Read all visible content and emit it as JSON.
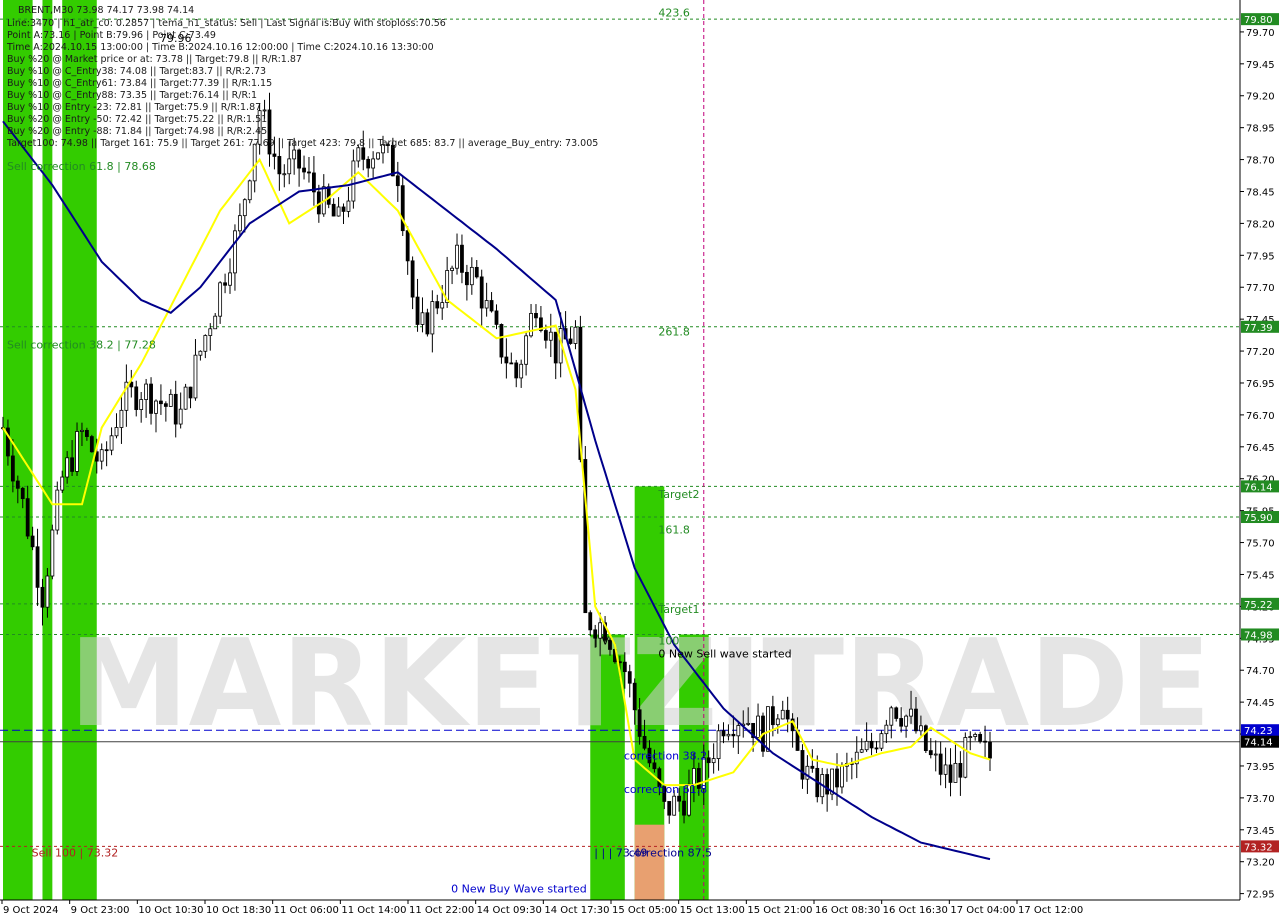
{
  "header": {
    "symbol_line": "BRENT,M30  73.98 74.17 73.98 74.14",
    "info_lines": [
      "Line:3470  | h1_atr_c0: 0.2857  | tema_h1_status:  Sell  | Last Signal is:Buy with stoploss:70.56",
      "Point A:73.16  | Point B:79.96  | Point C:73.49",
      "Time A:2024.10.15 13:00:00  | Time B:2024.10.16 12:00:00  | Time C:2024.10.16 13:30:00",
      "Buy %20 @ Market price or at: 73.78  || Target:79.8  || R/R:1.87",
      "Buy %10 @ C_Entry38: 74.08  || Target:83.7  || R/R:2.73",
      "Buy %10 @ C_Entry61: 73.84  || Target:77.39  || R/R:1.15",
      "Buy %10 @ C_Entry88: 73.35  || Target:76.14  || R/R:1",
      "Buy %10 @ Entry -23: 72.81  || Target:75.9  || R/R:1.87",
      "Buy %20 @ Entry -50: 72.42  || Target:75.22  || R/R:1.51",
      "Buy %20 @ Entry -88: 71.84  || Target:74.98  || R/R:2.45",
      "Target100: 74.98  || Target 161: 75.9  || Target 261: 77.69  || Target 423: 79.8  || Target 685: 83.7  || average_Buy_entry: 73.005"
    ]
  },
  "watermark": "MARKETZITRADE",
  "chart_data": {
    "type": "candlestick",
    "symbol": "BRENT",
    "timeframe": "M30",
    "ylim": [
      72.9,
      79.95
    ],
    "y_ticks": [
      "79.70",
      "79.45",
      "79.20",
      "78.95",
      "78.70",
      "78.45",
      "78.20",
      "77.95",
      "77.70",
      "77.45",
      "77.20",
      "76.95",
      "76.70",
      "76.45",
      "76.20",
      "75.95",
      "75.70",
      "75.45",
      "75.20",
      "74.95",
      "74.70",
      "74.45",
      "74.20",
      "73.95",
      "73.70",
      "73.45",
      "73.20",
      "72.95"
    ],
    "x_ticks": [
      "9 Oct 2024",
      "9 Oct 23:00",
      "10 Oct 10:30",
      "10 Oct 18:30",
      "11 Oct 06:00",
      "11 Oct 14:00",
      "11 Oct 22:00",
      "14 Oct 09:30",
      "14 Oct 17:30",
      "15 Oct 05:00",
      "15 Oct 13:00",
      "15 Oct 21:00",
      "16 Oct 08:30",
      "16 Oct 16:30",
      "17 Oct 04:00",
      "17 Oct 12:00"
    ],
    "series_close_keypoints": [
      [
        0,
        76.6
      ],
      [
        4,
        76.0
      ],
      [
        8,
        75.3
      ],
      [
        12,
        76.2
      ],
      [
        16,
        76.55
      ],
      [
        20,
        76.3
      ],
      [
        24,
        76.8
      ],
      [
        28,
        76.9
      ],
      [
        32,
        76.8
      ],
      [
        36,
        76.7
      ],
      [
        40,
        77.2
      ],
      [
        44,
        77.7
      ],
      [
        48,
        78.2
      ],
      [
        52,
        79.1
      ],
      [
        56,
        78.6
      ],
      [
        60,
        78.65
      ],
      [
        64,
        78.4
      ],
      [
        68,
        78.2
      ],
      [
        72,
        78.7
      ],
      [
        76,
        78.8
      ],
      [
        80,
        78.6
      ],
      [
        84,
        77.3
      ],
      [
        88,
        77.6
      ],
      [
        92,
        77.9
      ],
      [
        96,
        77.75
      ],
      [
        100,
        77.3
      ],
      [
        104,
        77.0
      ],
      [
        108,
        77.6
      ],
      [
        112,
        77.2
      ],
      [
        116,
        77.35
      ],
      [
        118,
        75.1
      ],
      [
        122,
        75.05
      ],
      [
        126,
        74.7
      ],
      [
        130,
        74.1
      ],
      [
        134,
        73.6
      ],
      [
        138,
        73.7
      ],
      [
        142,
        73.9
      ],
      [
        146,
        74.3
      ],
      [
        150,
        74.35
      ],
      [
        154,
        74.2
      ],
      [
        158,
        74.5
      ],
      [
        160,
        74.1
      ],
      [
        164,
        73.8
      ],
      [
        168,
        73.8
      ],
      [
        172,
        73.95
      ],
      [
        176,
        74.1
      ],
      [
        180,
        74.45
      ],
      [
        184,
        74.3
      ],
      [
        188,
        74.0
      ],
      [
        192,
        73.85
      ],
      [
        196,
        74.1
      ],
      [
        200,
        74.02
      ]
    ],
    "n_bars": 201,
    "series": [
      {
        "name": "",
        "color": "#ffff00"
      },
      {
        "name": "",
        "color": "#00008b"
      }
    ],
    "yellow_line_keypoints": [
      [
        0,
        76.6
      ],
      [
        10,
        76.0
      ],
      [
        16,
        76.0
      ],
      [
        20,
        76.6
      ],
      [
        28,
        77.1
      ],
      [
        36,
        77.7
      ],
      [
        44,
        78.3
      ],
      [
        52,
        78.7
      ],
      [
        58,
        78.2
      ],
      [
        66,
        78.4
      ],
      [
        72,
        78.6
      ],
      [
        80,
        78.3
      ],
      [
        90,
        77.6
      ],
      [
        100,
        77.3
      ],
      [
        112,
        77.4
      ],
      [
        116,
        76.9
      ],
      [
        120,
        75.2
      ],
      [
        124,
        74.9
      ],
      [
        128,
        74.0
      ],
      [
        134,
        73.8
      ],
      [
        140,
        73.8
      ],
      [
        148,
        73.9
      ],
      [
        154,
        74.2
      ],
      [
        160,
        74.3
      ],
      [
        164,
        74.0
      ],
      [
        170,
        73.95
      ],
      [
        178,
        74.05
      ],
      [
        184,
        74.1
      ],
      [
        188,
        74.25
      ],
      [
        196,
        74.05
      ],
      [
        200,
        74.0
      ]
    ],
    "blue_line_keypoints": [
      [
        0,
        79.0
      ],
      [
        10,
        78.5
      ],
      [
        20,
        77.9
      ],
      [
        28,
        77.6
      ],
      [
        34,
        77.5
      ],
      [
        40,
        77.7
      ],
      [
        50,
        78.2
      ],
      [
        60,
        78.45
      ],
      [
        70,
        78.5
      ],
      [
        80,
        78.6
      ],
      [
        90,
        78.3
      ],
      [
        100,
        78.0
      ],
      [
        112,
        77.6
      ],
      [
        120,
        76.5
      ],
      [
        128,
        75.5
      ],
      [
        136,
        74.9
      ],
      [
        146,
        74.4
      ],
      [
        156,
        74.05
      ],
      [
        166,
        73.8
      ],
      [
        176,
        73.55
      ],
      [
        186,
        73.35
      ],
      [
        200,
        73.22
      ]
    ],
    "horizontal_levels": [
      {
        "label": "77.39",
        "price": 77.39,
        "color": "#228b22",
        "style": "dotted"
      },
      {
        "label": "76.14",
        "price": 76.14,
        "color": "#228b22",
        "style": "dotted"
      },
      {
        "label": "75.90",
        "price": 75.9,
        "color": "#228b22",
        "style": "dotted"
      },
      {
        "label": "75.22",
        "price": 75.22,
        "color": "#228b22",
        "style": "dotted"
      },
      {
        "label": "74.98",
        "price": 74.98,
        "color": "#228b22",
        "style": "dotted"
      },
      {
        "label": "74.23",
        "price": 74.23,
        "color": "#0000cd",
        "style": "dashed"
      },
      {
        "label": "74.14",
        "price": 74.14,
        "color": "#404040",
        "style": "solid"
      },
      {
        "label": "73.32",
        "price": 73.32,
        "color": "#b22222",
        "style": "dotted"
      },
      {
        "label": "79.80",
        "price": 79.8,
        "color": "#228b22",
        "style": "dotted"
      }
    ],
    "annotations": [
      {
        "text": "423.6",
        "price": 79.82,
        "bar": 132,
        "color": "#228b22"
      },
      {
        "text": "261.8",
        "price": 77.32,
        "bar": 132,
        "color": "#228b22"
      },
      {
        "text": "Target2",
        "price": 76.05,
        "bar": 132,
        "color": "#228b22"
      },
      {
        "text": "161.8",
        "price": 75.77,
        "bar": 132,
        "color": "#228b22"
      },
      {
        "text": "Target1",
        "price": 75.15,
        "bar": 132,
        "color": "#228b22"
      },
      {
        "text": "100",
        "price": 74.9,
        "bar": 132,
        "color": "#228b22"
      },
      {
        "text": "0 New Sell wave started",
        "price": 74.8,
        "bar": 132,
        "color": "#000000"
      },
      {
        "text": "Sell correction 61.8 | 78.68",
        "price": 78.62,
        "bar": 0,
        "color": "#228b22"
      },
      {
        "text": "Sell correction 38.2 | 77.28",
        "price": 77.22,
        "bar": 0,
        "color": "#228b22"
      },
      {
        "text": "Sell 100 | 73.32",
        "price": 73.24,
        "bar": 5,
        "color": "#b22222"
      },
      {
        "text": "| V",
        "price": 74.9,
        "bar": 119,
        "color": "#000000"
      },
      {
        "text": "correction 38.2",
        "price": 74.0,
        "bar": 125,
        "color": "#0000cd"
      },
      {
        "text": "correction 61.8",
        "price": 73.74,
        "bar": 125,
        "color": "#0000cd"
      },
      {
        "text": "| | | 73.49",
        "price": 73.24,
        "bar": 119,
        "color": "#00008b"
      },
      {
        "text": "correction 87.5",
        "price": 73.24,
        "bar": 126,
        "color": "#00008b"
      },
      {
        "text": "79.96",
        "price": 79.62,
        "bar": 31,
        "color": "#000000"
      },
      {
        "text": "0 New Buy Wave started",
        "price": 72.96,
        "bar": 90,
        "color": "#0000cd"
      }
    ],
    "zones": [
      {
        "from_bar": 0,
        "to_bar": 6,
        "color": "#33cc00",
        "from_price": 72.9,
        "to_price": 79.95
      },
      {
        "from_bar": 8,
        "to_bar": 10,
        "color": "#33cc00",
        "from_price": 72.9,
        "to_price": 79.95
      },
      {
        "from_bar": 12,
        "to_bar": 19,
        "color": "#33cc00",
        "from_price": 72.9,
        "to_price": 79.95
      },
      {
        "from_bar": 119,
        "to_bar": 126,
        "color": "#33cc00",
        "from_price": 72.9,
        "to_price": 74.98
      },
      {
        "from_bar": 128,
        "to_bar": 134,
        "color": "#33cc00",
        "from_price": 72.9,
        "to_price": 76.14
      },
      {
        "from_bar": 128,
        "to_bar": 134,
        "color": "#e8a070",
        "from_price": 72.9,
        "to_price": 73.49
      },
      {
        "from_bar": 137,
        "to_bar": 143,
        "color": "#33cc00",
        "from_price": 72.9,
        "to_price": 74.98
      }
    ],
    "vline_bar": 142,
    "watermark_color": "#d0d0d0",
    "grid": false,
    "legend": "none"
  }
}
